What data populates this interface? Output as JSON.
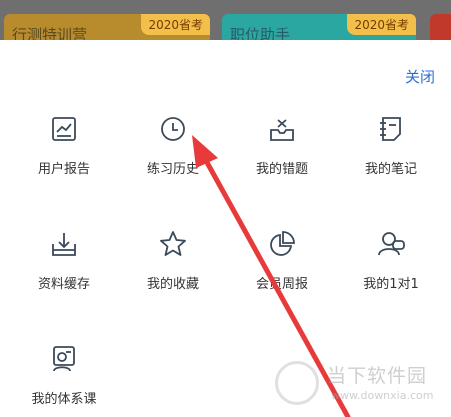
{
  "banners": [
    {
      "text": "行测特训营",
      "tag": "2020省考"
    },
    {
      "text": "职位助手",
      "tag": "2020省考"
    }
  ],
  "sheet": {
    "close_label": "关闭",
    "items": [
      {
        "label": "用户报告",
        "icon": "report-chart-icon"
      },
      {
        "label": "练习历史",
        "icon": "clock-icon"
      },
      {
        "label": "我的错题",
        "icon": "wrong-tray-icon"
      },
      {
        "label": "我的笔记",
        "icon": "note-icon"
      },
      {
        "label": "资料缓存",
        "icon": "download-tray-icon"
      },
      {
        "label": "我的收藏",
        "icon": "star-icon"
      },
      {
        "label": "会员周报",
        "icon": "pie-chart-icon"
      },
      {
        "label": "我的1对1",
        "icon": "tutor-chat-icon"
      },
      {
        "label": "我的体系课",
        "icon": "course-screen-icon"
      }
    ]
  },
  "watermark": {
    "name": "当下软件园",
    "url": "www.downxia.com"
  },
  "colors": {
    "accent": "#2f6fd1",
    "arrow": "#e83a3a",
    "icon": "#3b4a5a"
  }
}
